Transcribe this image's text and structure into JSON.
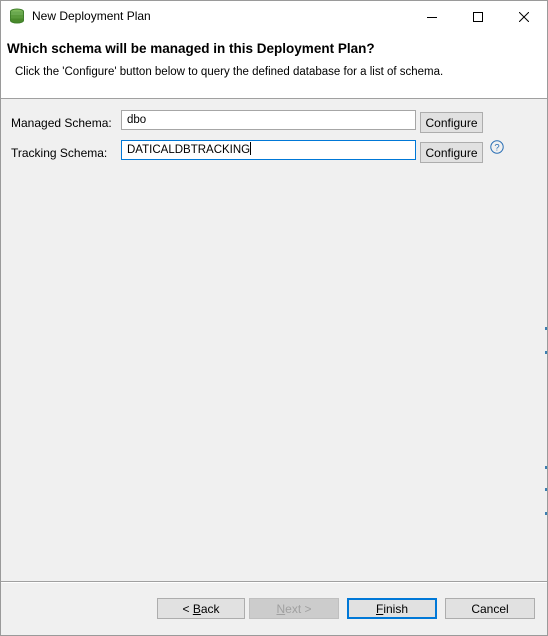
{
  "window": {
    "title": "New Deployment Plan",
    "controls": [
      "minimize-icon",
      "maximize-icon",
      "close-icon"
    ]
  },
  "banner": {
    "title": "Which schema will be managed in this Deployment Plan?",
    "description": "Click the 'Configure' button below to query the defined database for a list of schema."
  },
  "form": {
    "managed_schema": {
      "label": "Managed Schema:",
      "value": "dbo",
      "button_label": "Configure"
    },
    "tracking_schema": {
      "label": "Tracking Schema:",
      "value": "DATICALDBTRACKING",
      "button_label": "Configure"
    },
    "help_icon": "question-mark-icon"
  },
  "footer": {
    "back": {
      "prefix": "< ",
      "mnemonic": "B",
      "rest": "ack",
      "enabled": true
    },
    "next": {
      "mnemonic": "N",
      "rest": "ext",
      "suffix": " >",
      "enabled": false
    },
    "finish": {
      "mnemonic": "F",
      "rest": "inish",
      "enabled": true
    },
    "cancel": {
      "label": "Cancel",
      "enabled": true
    }
  },
  "colors": {
    "focus_border": "#0078d7",
    "window_bg": "#f0f0f0",
    "banner_bg": "#ffffff",
    "app_icon": "#5a9a3c"
  }
}
